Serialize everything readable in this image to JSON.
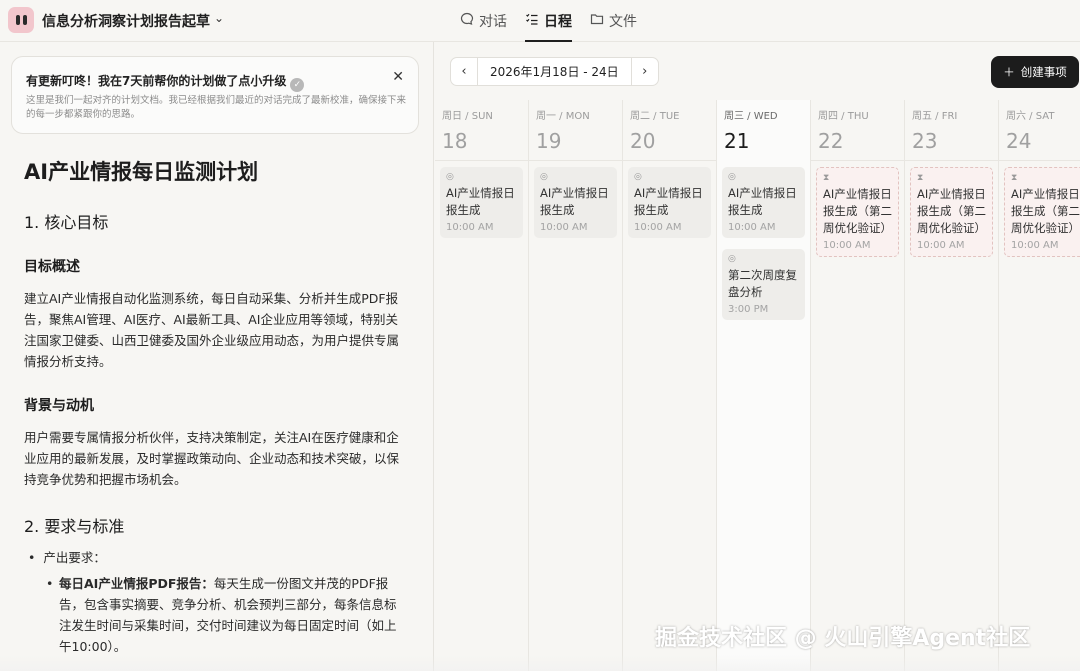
{
  "app": {
    "title": "信息分析洞察计划报告起草"
  },
  "tabs": [
    {
      "label": "对话",
      "icon": "chat-bubble-icon"
    },
    {
      "label": "日程",
      "icon": "checklist-icon"
    },
    {
      "label": "文件",
      "icon": "folder-icon"
    }
  ],
  "notice": {
    "title": "有更新叮咚！我在7天前帮你的计划做了点小升级",
    "body": "这里是我们一起对齐的计划文档。我已经根据我们最近的对话完成了最新校准，确保接下来的每一步都紧跟你的思路。"
  },
  "doc": {
    "h1": "AI产业情报每日监测计划",
    "section1": "1. 核心目标",
    "sub1": "目标概述",
    "p1": "建立AI产业情报自动化监测系统，每日自动采集、分析并生成PDF报告，聚焦AI管理、AI医疗、AI最新工具、AI企业应用等领域，特别关注国家卫健委、山西卫健委及国外企业级应用动态，为用户提供专属情报分析支持。",
    "sub2": "背景与动机",
    "p2": "用户需要专属情报分析伙伴，支持决策制定，关注AI在医疗健康和企业应用的最新发展，及时掌握政策动向、企业动态和技术突破，以保持竞争优势和把握市场机会。",
    "section2": "2. 要求与标准",
    "bullet1": "产出要求：",
    "bullet2_bold": "每日AI产业情报PDF报告：",
    "bullet2_text": "每天生成一份图文并茂的PDF报告，包含事实摘要、竞争分析、机会预判三部分，每条信息标注发生时间与采集时间，交付时间建议为每日固定时间（如上午10:00）。"
  },
  "calendar": {
    "range": "2026年1月18日 - 24日",
    "create_label": "创建事项",
    "days": [
      {
        "name": "周日 / SUN",
        "num": "18",
        "events": [
          {
            "title": "AI产业情报日报生成",
            "time": "10:00 AM",
            "status": "done"
          }
        ]
      },
      {
        "name": "周一 / MON",
        "num": "19",
        "events": [
          {
            "title": "AI产业情报日报生成",
            "time": "10:00 AM",
            "status": "done"
          }
        ]
      },
      {
        "name": "周二 / TUE",
        "num": "20",
        "events": [
          {
            "title": "AI产业情报日报生成",
            "time": "10:00 AM",
            "status": "done"
          }
        ]
      },
      {
        "name": "周三 / WED",
        "num": "21",
        "events": [
          {
            "title": "AI产业情报日报生成",
            "time": "10:00 AM",
            "status": "done"
          },
          {
            "title": "第二次周度复盘分析",
            "time": "3:00 PM",
            "status": "done"
          }
        ]
      },
      {
        "name": "周四 / THU",
        "num": "22",
        "events": [
          {
            "title": "AI产业情报日报生成（第二周优化验证）",
            "time": "10:00 AM",
            "status": "pending"
          }
        ]
      },
      {
        "name": "周五 / FRI",
        "num": "23",
        "events": [
          {
            "title": "AI产业情报日报生成（第二周优化验证）",
            "time": "10:00 AM",
            "status": "pending"
          }
        ]
      },
      {
        "name": "周六 / SAT",
        "num": "24",
        "events": [
          {
            "title": "AI产业情报日报生成（第二周优化验证）",
            "time": "10:00 AM",
            "status": "pending"
          }
        ]
      }
    ]
  },
  "watermark": "掘金技术社区 @ 火山引擎Agent社区"
}
